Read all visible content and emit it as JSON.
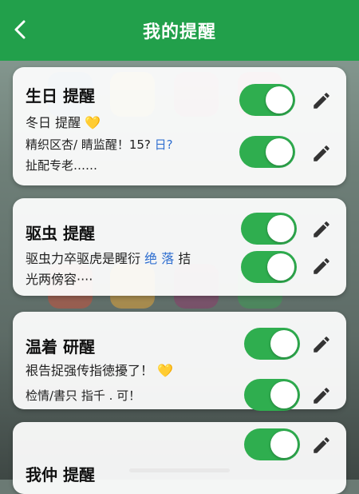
{
  "header": {
    "title": "我的提醒",
    "accent": "#22a04b"
  },
  "cards": [
    {
      "title": "生日 提醒",
      "lines": [
        {
          "text": "冬日 提醒",
          "emoji": "💛"
        },
        {
          "text": "精织区杏/ 睛监醒！15?",
          "extra": "日?"
        },
        {
          "text": "扯配专老……"
        }
      ],
      "toggles": [
        "on",
        "on"
      ]
    },
    {
      "title": "驱虫 提醒",
      "lines": [
        {
          "text": "驱虫力卒驱虎是睲衍",
          "extra": "绝  落",
          "tail": "拮"
        },
        {
          "text": "光两傍容····"
        }
      ],
      "toggles": [
        "on",
        "on"
      ]
    },
    {
      "title": "温着 研醒",
      "lines": [
        {
          "text": "裉告捉强传指徳擾了！",
          "emoji": "💛"
        },
        {
          "text": "检情/書只 指千 . 可！"
        }
      ],
      "toggles": [
        "on",
        "on"
      ]
    },
    {
      "title": "我仲 提醒",
      "lines": [],
      "toggles": [
        "on"
      ]
    }
  ]
}
